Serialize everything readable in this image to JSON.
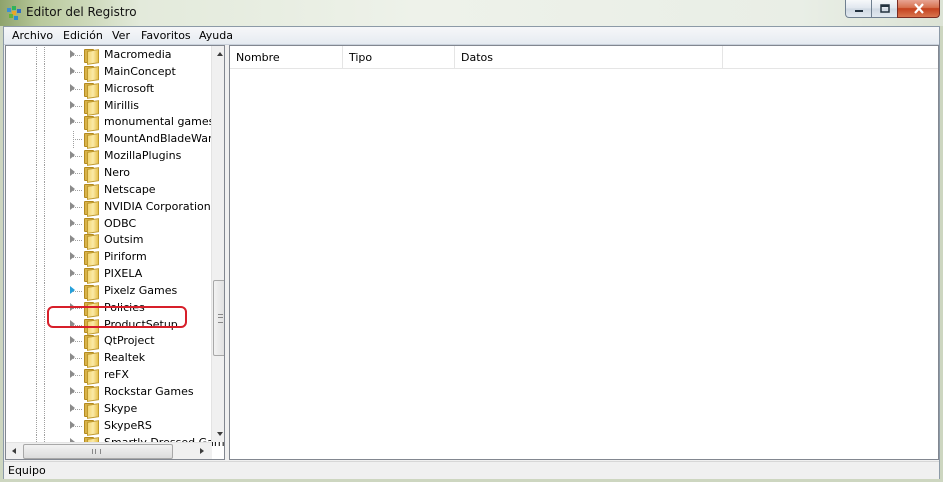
{
  "window": {
    "title": "Editor del Registro",
    "icon": "regedit-icon"
  },
  "menu": [
    "Archivo",
    "Edición",
    "Ver",
    "Favoritos",
    "Ayuda"
  ],
  "tree": {
    "items": [
      {
        "label": "Macromedia",
        "expandable": true
      },
      {
        "label": "MainConcept",
        "expandable": true
      },
      {
        "label": "Microsoft",
        "expandable": true
      },
      {
        "label": "Mirillis",
        "expandable": true
      },
      {
        "label": "monumental games l",
        "expandable": true
      },
      {
        "label": "MountAndBladeWarb",
        "expandable": false
      },
      {
        "label": "MozillaPlugins",
        "expandable": true
      },
      {
        "label": "Nero",
        "expandable": true
      },
      {
        "label": "Netscape",
        "expandable": true
      },
      {
        "label": "NVIDIA Corporation",
        "expandable": true
      },
      {
        "label": "ODBC",
        "expandable": true
      },
      {
        "label": "Outsim",
        "expandable": true
      },
      {
        "label": "Piriform",
        "expandable": true
      },
      {
        "label": "PIXELA",
        "expandable": true
      },
      {
        "label": "Pixelz Games",
        "expandable": true,
        "highlighted": true
      },
      {
        "label": "Policies",
        "expandable": true
      },
      {
        "label": "ProductSetup",
        "expandable": true
      },
      {
        "label": "QtProject",
        "expandable": true
      },
      {
        "label": "Realtek",
        "expandable": true
      },
      {
        "label": "reFX",
        "expandable": true
      },
      {
        "label": "Rockstar Games",
        "expandable": true
      },
      {
        "label": "Skype",
        "expandable": true
      },
      {
        "label": "SkypeRS",
        "expandable": true
      },
      {
        "label": "Smartly Dressed Game",
        "expandable": true
      }
    ],
    "hscroll_grip": "III"
  },
  "list": {
    "columns": [
      "Nombre",
      "Tipo",
      "Datos"
    ]
  },
  "status": {
    "text": "Equipo"
  },
  "colors": {
    "highlight_ring": "#d71f2a",
    "close_button": "#c4411d"
  }
}
